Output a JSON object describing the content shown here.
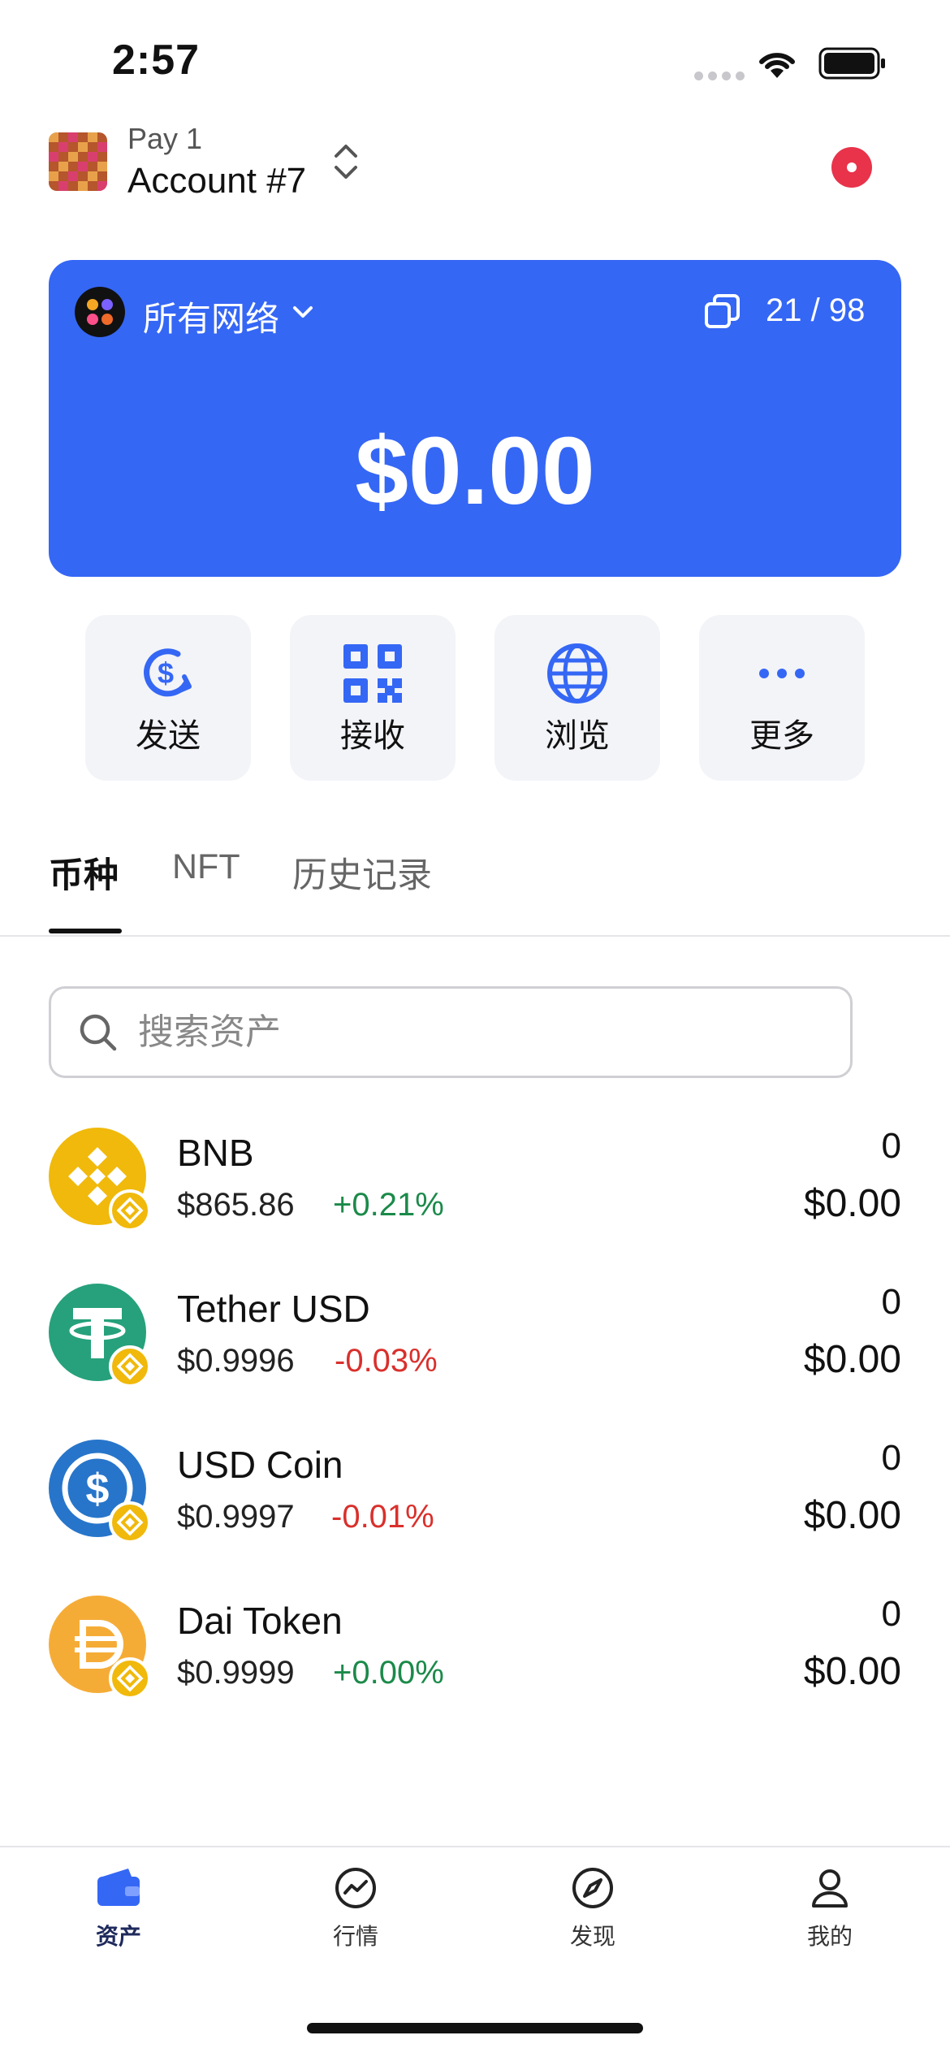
{
  "status_bar": {
    "time": "2:57"
  },
  "header": {
    "wallet_name": "Pay 1",
    "account_name": "Account #7"
  },
  "balance_card": {
    "network_label": "所有网络",
    "token_count": "21 / 98",
    "total_balance": "$0.00",
    "color": "#3567f5"
  },
  "actions": [
    {
      "label": "发送",
      "icon": "send-dollar-icon"
    },
    {
      "label": "接收",
      "icon": "qr-code-icon"
    },
    {
      "label": "浏览",
      "icon": "globe-icon"
    },
    {
      "label": "更多",
      "icon": "more-dots-icon"
    }
  ],
  "tabs": [
    {
      "label": "币种",
      "active": true
    },
    {
      "label": "NFT",
      "active": false
    },
    {
      "label": "历史记录",
      "active": false
    }
  ],
  "search": {
    "placeholder": "搜索资产",
    "value": ""
  },
  "tokens": [
    {
      "name": "BNB",
      "price": "$865.86",
      "change": "+0.21%",
      "direction": "up",
      "amount": "0",
      "value": "$0.00",
      "icon": "bnb-logo-icon"
    },
    {
      "name": "Tether USD",
      "price": "$0.9996",
      "change": "-0.03%",
      "direction": "down",
      "amount": "0",
      "value": "$0.00",
      "icon": "tether-logo-icon"
    },
    {
      "name": "USD Coin",
      "price": "$0.9997",
      "change": "-0.01%",
      "direction": "down",
      "amount": "0",
      "value": "$0.00",
      "icon": "usdc-logo-icon"
    },
    {
      "name": "Dai Token",
      "price": "$0.9999",
      "change": "+0.00%",
      "direction": "up",
      "amount": "0",
      "value": "$0.00",
      "icon": "dai-logo-icon"
    }
  ],
  "bottom_nav": [
    {
      "label": "资产",
      "icon": "wallet-icon",
      "active": true
    },
    {
      "label": "行情",
      "icon": "chart-icon",
      "active": false
    },
    {
      "label": "发现",
      "icon": "compass-icon",
      "active": false
    },
    {
      "label": "我的",
      "icon": "user-icon",
      "active": false
    }
  ],
  "colors": {
    "accent": "#3567f5",
    "positive": "#1b8a4a",
    "negative": "#d9302c",
    "bnb": "#f0b90b"
  }
}
